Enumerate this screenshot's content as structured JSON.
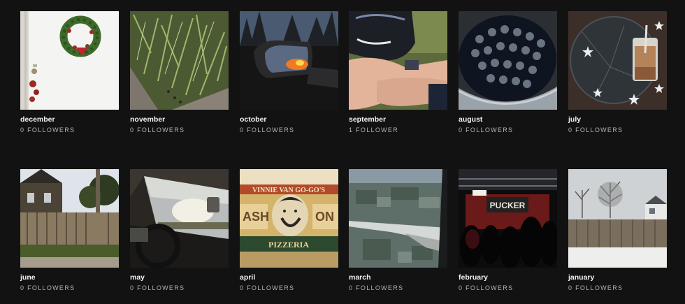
{
  "playlists": [
    {
      "name": "december",
      "followers": "0 FOLLOWERS",
      "icon": "wreath-door-photo"
    },
    {
      "name": "november",
      "followers": "0 FOLLOWERS",
      "icon": "grass-photo"
    },
    {
      "name": "october",
      "followers": "0 FOLLOWERS",
      "icon": "car-mirror-sunset-photo"
    },
    {
      "name": "september",
      "followers": "1 FOLLOWER",
      "icon": "legs-sneakers-photo"
    },
    {
      "name": "august",
      "followers": "0 FOLLOWERS",
      "icon": "bowl-of-cans-photo"
    },
    {
      "name": "july",
      "followers": "0 FOLLOWERS",
      "icon": "iced-coffee-table-photo"
    },
    {
      "name": "june",
      "followers": "0 FOLLOWERS",
      "icon": "house-fence-photo"
    },
    {
      "name": "may",
      "followers": "0 FOLLOWERS",
      "icon": "car-interior-photo"
    },
    {
      "name": "april",
      "followers": "0 FOLLOWERS",
      "icon": "pizzeria-sign-photo"
    },
    {
      "name": "march",
      "followers": "0 FOLLOWERS",
      "icon": "airplane-window-photo"
    },
    {
      "name": "february",
      "followers": "0 FOLLOWERS",
      "icon": "concert-stage-photo"
    },
    {
      "name": "january",
      "followers": "0 FOLLOWERS",
      "icon": "snowy-yard-photo"
    }
  ],
  "sign_text": {
    "top": "VINNIE VAN GO-GO'S",
    "left": "ASH",
    "right": "ON",
    "bottom": "PIZZERIA"
  },
  "stage_banner": "PUCKER",
  "colors": {
    "background": "#121212",
    "title": "#f2f2f2",
    "subtitle": "#b3b3b3"
  }
}
